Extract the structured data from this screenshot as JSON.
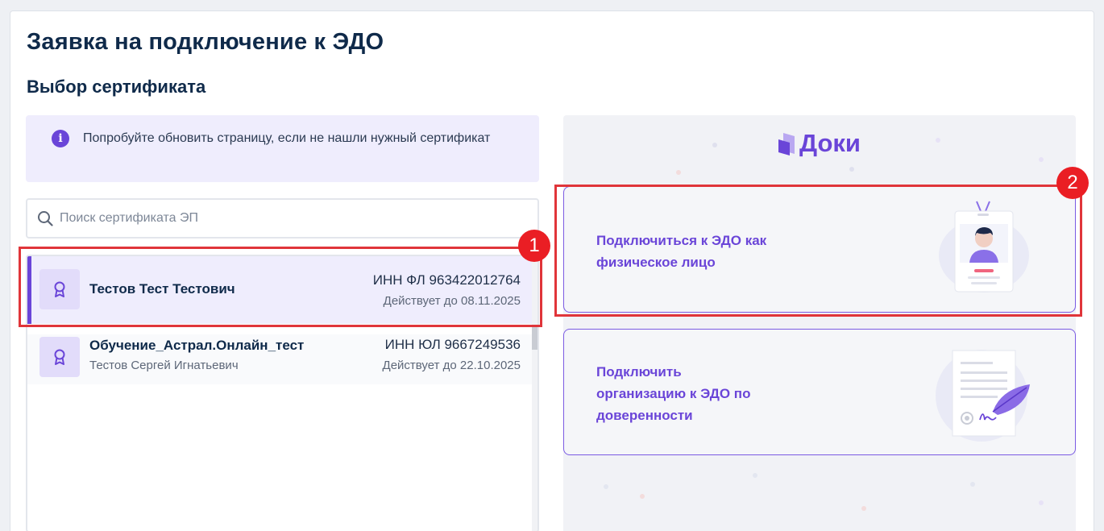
{
  "page": {
    "title": "Заявка на подключение к ЭДО",
    "section": "Выбор сертификата"
  },
  "info": {
    "text": "Попробуйте обновить страницу, если не нашли нужный сертификат",
    "icon": "info-icon"
  },
  "search": {
    "placeholder": "Поиск сертификата ЭП",
    "value": ""
  },
  "certificates": [
    {
      "name": "Тестов Тест Тестович",
      "owner": "",
      "inn": "ИНН ФЛ 963422012764",
      "valid": "Действует до 08.11.2025",
      "selected": true
    },
    {
      "name": "Обучение_Астрал.Онлайн_тест",
      "owner": "Тестов Сергей Игнатьевич",
      "inn": "ИНН ЮЛ 9667249536",
      "valid": "Действует до 22.10.2025",
      "selected": false
    }
  ],
  "brand": {
    "name": "Доки",
    "accent": "#6a45d8"
  },
  "options": [
    {
      "label_line1": "Подключиться к ЭДО как",
      "label_line2": "физическое лицо"
    },
    {
      "label_line1": "Подключить",
      "label_line2": "организацию к ЭДО по",
      "label_line3": "доверенности"
    }
  ],
  "annotations": [
    "1",
    "2"
  ]
}
